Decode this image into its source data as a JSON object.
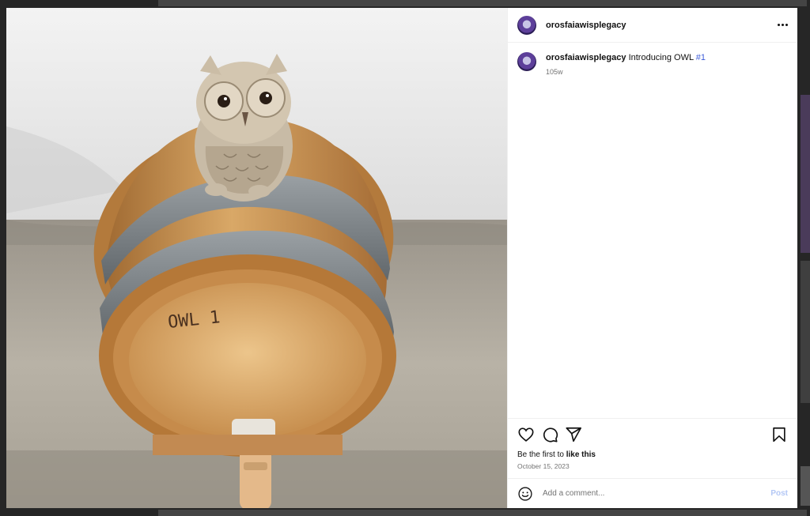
{
  "post": {
    "username": "orosfaiawisplegacy",
    "caption_text": "Introducing OWL",
    "hashtag": "#1",
    "age": "105w",
    "likes_prefix": "Be the first to",
    "likes_action": "like this",
    "date": "October 15, 2023",
    "barrel_text": "OWL 1"
  },
  "comment": {
    "placeholder": "Add a comment...",
    "post_label": "Post"
  },
  "icons": {
    "more": "more-horizontal-icon",
    "like": "heart-icon",
    "comment": "comment-bubble-icon",
    "share": "paper-plane-icon",
    "save": "bookmark-icon",
    "emoji": "emoji-icon"
  },
  "colors": {
    "hashtag": "#3b5bd8",
    "post_button": "#b3c7f5",
    "secondary_text": "#737373"
  }
}
